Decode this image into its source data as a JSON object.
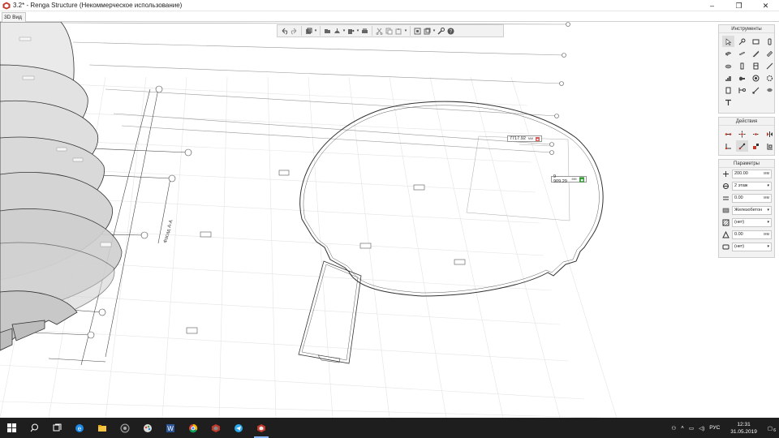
{
  "window": {
    "title": "3.2* - Renga Structure (Некоммерческое использование)",
    "controls": [
      "–",
      "❐",
      "✕"
    ]
  },
  "tabs": [
    {
      "label": "3D Вид"
    }
  ],
  "toolbar": {
    "buttons": [
      "undo-icon",
      "redo-icon",
      "view-cube-icon",
      "section-icon",
      "level-icon",
      "export-icon",
      "print-icon",
      "cut-icon",
      "copy-icon",
      "paste-icon",
      "paste-special-icon",
      "properties-icon",
      "settings-wrench-icon",
      "help-icon"
    ]
  },
  "panels": {
    "tools": {
      "title": "Инструменты"
    },
    "actions": {
      "title": "Действия"
    },
    "params": {
      "title": "Параметры",
      "rows": [
        {
          "icon": "height-icon",
          "value": "200.00",
          "unit": "мм"
        },
        {
          "icon": "level-icon",
          "value": "2 этаж",
          "dropdown": true
        },
        {
          "icon": "offset-icon",
          "value": "0.00",
          "unit": "мм"
        },
        {
          "icon": "material-icon",
          "value": "Железобетон",
          "dropdown": true
        },
        {
          "icon": "hatch-icon",
          "value": "(нет)",
          "dropdown": true
        },
        {
          "icon": "angle-icon",
          "value": "0.00",
          "unit": "мм"
        },
        {
          "icon": "style-icon",
          "value": "(нет)",
          "dropdown": true
        }
      ]
    }
  },
  "scene": {
    "dim_input_1": {
      "value": "7717.92",
      "unit": "мм"
    },
    "dim_input_2": {
      "value": "9 909.29",
      "unit": "мм"
    },
    "level_labels": [
      "1 этаж",
      "2 этаж",
      "3 этаж",
      "4 этаж"
    ],
    "axis_labels": [
      "А",
      "Б",
      "В",
      "Г",
      "Д"
    ],
    "section_label": "Фасад А-А"
  },
  "taskbar": {
    "apps": [
      "windows-start-icon",
      "search-icon",
      "task-view-icon",
      "edge-icon",
      "file-explorer-icon",
      "app-icon",
      "paint-icon",
      "word-icon",
      "chrome-icon",
      "renga-icon",
      "telegram-icon",
      "renga-active-icon"
    ],
    "language": "РУС",
    "time": "12:31",
    "date": "31.05.2019",
    "notifications": "6"
  }
}
